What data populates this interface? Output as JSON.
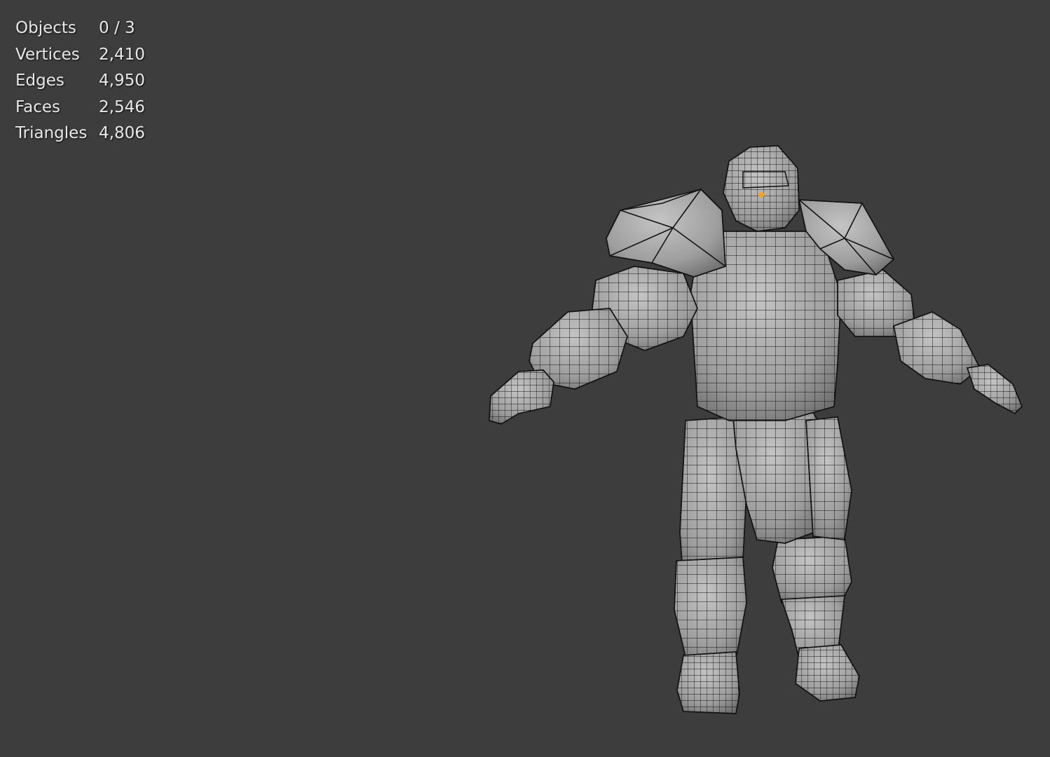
{
  "viewport": {
    "background": "#3d3d3d",
    "mode": "wireframe-overlay",
    "origin_color": "#f5a020",
    "mesh_color": "#9a9a9a",
    "wire_color": "#141414"
  },
  "stats": [
    {
      "label": "Objects",
      "value": "0 / 3"
    },
    {
      "label": "Vertices",
      "value": "2,410"
    },
    {
      "label": "Edges",
      "value": "4,950"
    },
    {
      "label": "Faces",
      "value": "2,546"
    },
    {
      "label": "Triangles",
      "value": "4,806"
    }
  ]
}
